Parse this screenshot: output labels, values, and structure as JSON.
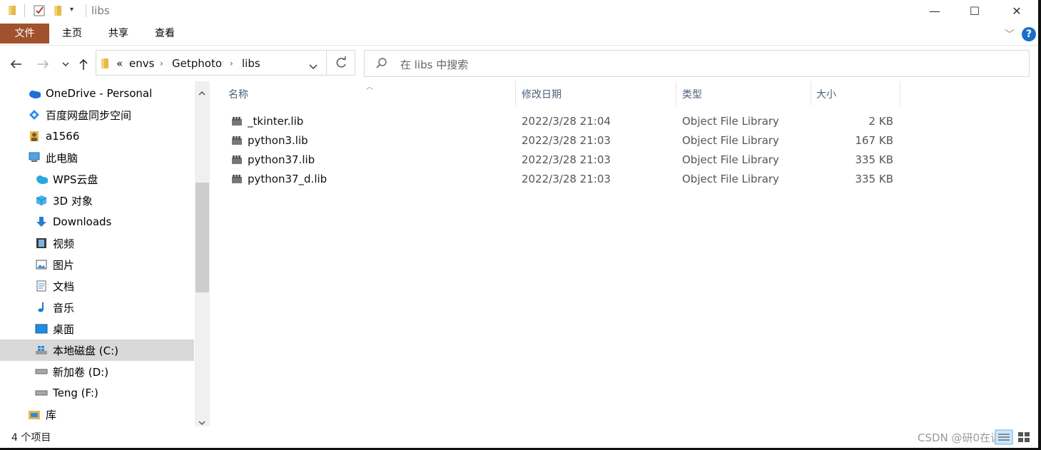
{
  "window": {
    "title": "libs",
    "minimize": "—",
    "maximize": "☐",
    "close": "✕"
  },
  "ribbon": {
    "tabs": [
      "文件",
      "主页",
      "共享",
      "查看"
    ],
    "help": "?"
  },
  "address": {
    "prefix": "«",
    "crumbs": [
      "envs",
      "Getphoto",
      "libs"
    ]
  },
  "search": {
    "placeholder": "在 libs 中搜索"
  },
  "nav": {
    "items": [
      {
        "label": "OneDrive - Personal",
        "icon": "cloud-icon"
      },
      {
        "label": "百度网盘同步空间",
        "icon": "baidu-sync-icon"
      },
      {
        "label": "a1566",
        "icon": "user-icon"
      },
      {
        "label": "此电脑",
        "icon": "computer-icon"
      },
      {
        "label": "WPS云盘",
        "icon": "wps-cloud-icon"
      },
      {
        "label": "3D 对象",
        "icon": "cube-icon"
      },
      {
        "label": "Downloads",
        "icon": "download-arrow-icon"
      },
      {
        "label": "视频",
        "icon": "film-icon"
      },
      {
        "label": "图片",
        "icon": "picture-icon"
      },
      {
        "label": "文档",
        "icon": "document-icon"
      },
      {
        "label": "音乐",
        "icon": "music-note-icon"
      },
      {
        "label": "桌面",
        "icon": "desktop-icon"
      },
      {
        "label": "本地磁盘 (C:)",
        "icon": "windows-drive-icon"
      },
      {
        "label": "新加卷 (D:)",
        "icon": "drive-icon"
      },
      {
        "label": "Teng (F:)",
        "icon": "drive-icon"
      },
      {
        "label": "库",
        "icon": "library-icon"
      }
    ],
    "selected_index": 12
  },
  "columns": {
    "name": "名称",
    "date": "修改日期",
    "type": "类型",
    "size": "大小"
  },
  "files": [
    {
      "name": "_tkinter.lib",
      "date": "2022/3/28 21:04",
      "type": "Object File Library",
      "size": "2 KB"
    },
    {
      "name": "python3.lib",
      "date": "2022/3/28 21:03",
      "type": "Object File Library",
      "size": "167 KB"
    },
    {
      "name": "python37.lib",
      "date": "2022/3/28 21:03",
      "type": "Object File Library",
      "size": "335 KB"
    },
    {
      "name": "python37_d.lib",
      "date": "2022/3/28 21:03",
      "type": "Object File Library",
      "size": "335 KB"
    }
  ],
  "status": {
    "count": "4 个项目"
  },
  "watermark": "CSDN @研0在读生",
  "colors": {
    "file_tab": "#a0522d",
    "selected_nav": "#d9d9d9",
    "help": "#1a6fc9"
  }
}
